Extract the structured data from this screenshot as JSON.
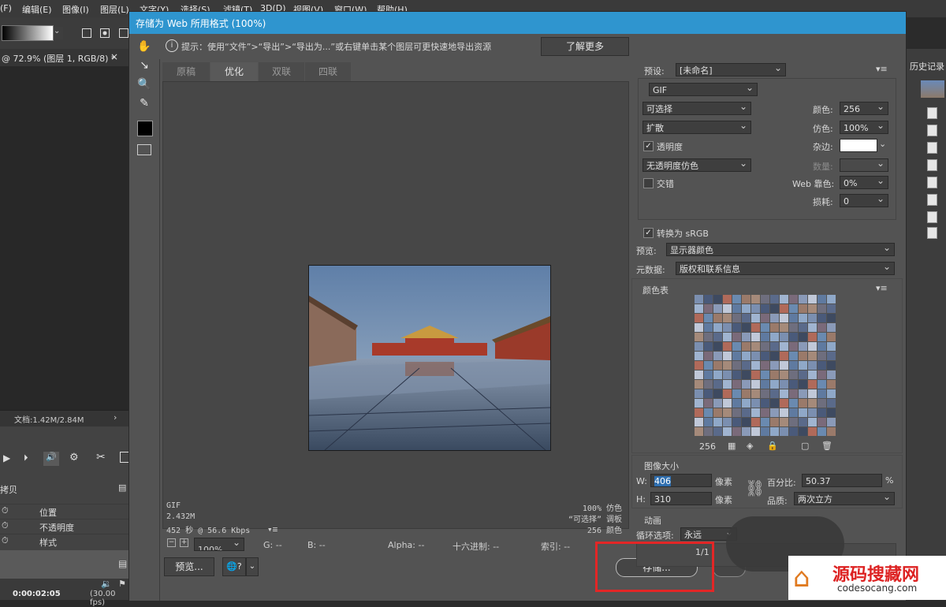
{
  "ps": {
    "menu": [
      "(F)",
      "编辑(E)",
      "图像(I)",
      "图层(L)",
      "文字(Y)",
      "选择(S)",
      "滤镜(T)",
      "3D(D)",
      "视图(V)",
      "窗口(W)",
      "帮助(H)"
    ],
    "doc_tab": "@ 72.9% (图层 1, RGB/8) *",
    "doc_info": "文档:1.42M/2.84M",
    "timeline_rows": [
      {
        "label": "拷贝"
      },
      {
        "label": "位置"
      },
      {
        "label": "不透明度"
      },
      {
        "label": "样式"
      }
    ],
    "timecode": "0:00:02:05",
    "fps": "(30.00 fps)",
    "history_title": "历史记录"
  },
  "dialog": {
    "title": "存储为 Web 所用格式 (100%)",
    "tip": "提示：使用“文件”>“导出”>“导出为...”或右键单击某个图层可更快速地导出资源",
    "learn_more": "了解更多",
    "tabs": [
      "原稿",
      "优化",
      "双联",
      "四联"
    ],
    "active_tab": "优化",
    "image_info": {
      "format": "GIF",
      "size": "2.432M",
      "time": "452 秒 @ 56.6 Kbps",
      "dither": "100% 仿色",
      "palette": "“可选择” 调板",
      "colors": "256 颜色"
    },
    "status": {
      "zoom": "100%",
      "g": "G: --",
      "b": "B: --",
      "alpha": "Alpha: --",
      "hex": "十六进制: --",
      "index": "索引: --"
    },
    "preview_button": "预览...",
    "save_button": "存储...",
    "settings": {
      "preset_label": "预设:",
      "preset_value": "[未命名]",
      "format": "GIF",
      "reduction": "可选择",
      "colors_label": "颜色:",
      "colors_value": "256",
      "dither_algo": "扩散",
      "dither_label": "仿色:",
      "dither_value": "100%",
      "transparency_label": "透明度",
      "matte_label": "杂边:",
      "trans_dither": "无透明度仿色",
      "amount_label": "数量:",
      "interlaced_label": "交错",
      "web_snap_label": "Web 靠色:",
      "web_snap_value": "0%",
      "lossy_label": "损耗:",
      "lossy_value": "0",
      "srgb_label": "转换为 sRGB",
      "preview_label": "预览:",
      "preview_value": "显示器颜色",
      "metadata_label": "元数据:",
      "metadata_value": "版权和联系信息",
      "color_table_label": "颜色表",
      "color_count": "256",
      "image_size_label": "图像大小",
      "w_label": "W:",
      "w_value": "406",
      "h_label": "H:",
      "h_value": "310",
      "px": "像素",
      "percent_label": "百分比:",
      "percent_value": "50.37",
      "percent_unit": "%",
      "quality_label": "品质:",
      "quality_value": "两次立方",
      "animation_label": "动画",
      "loop_label": "循环选项:",
      "loop_value": "永远",
      "frame": "1/1"
    }
  },
  "watermark": {
    "name": "源码搜藏网",
    "url": "codesocang.com"
  },
  "colors": {
    "titlebar": "#2f95cf",
    "dialog_bg": "#535353",
    "highlight": "#e32626"
  }
}
